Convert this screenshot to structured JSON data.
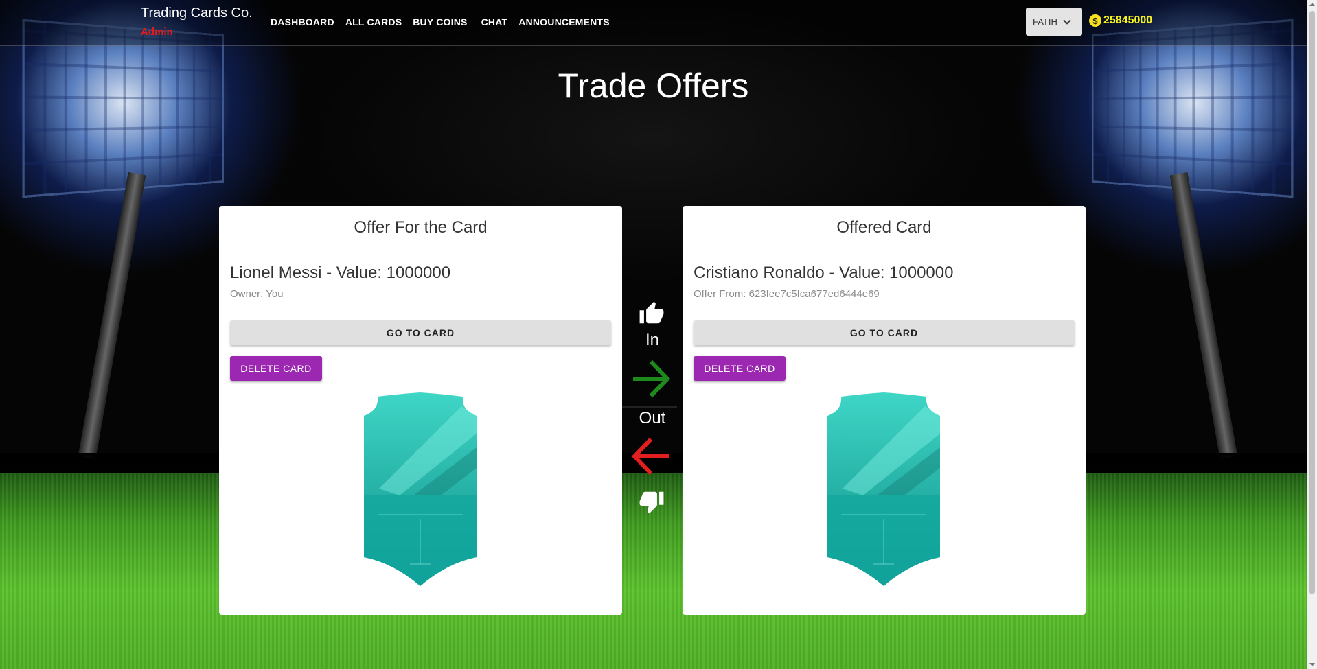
{
  "navbar": {
    "brand": "Trading Cards Co.",
    "role": "Admin",
    "links": [
      "DASHBOARD",
      "ALL CARDS",
      "BUY COINS",
      "CHAT",
      "ANNOUNCEMENTS"
    ],
    "user": "FATIH",
    "coins": "25845000",
    "coin_icon": "dollar-coin-icon"
  },
  "page": {
    "title": "Trade Offers"
  },
  "offer_card": {
    "title": "Offer For the Card",
    "player": "Lionel Messi - Value: 1000000",
    "subtitle": "Owner: You",
    "goto_label": "GO TO CARD",
    "delete_label": "DELETE CARD"
  },
  "offered_card": {
    "title": "Offered Card",
    "player": "Cristiano Ronaldo - Value: 1000000",
    "subtitle": "Offer From: 623fee7c5fca677ed6444e69",
    "goto_label": "GO TO CARD",
    "delete_label": "DELETE CARD"
  },
  "middle": {
    "in_label": "In",
    "out_label": "Out",
    "accept_icon": "thumbs-up-icon",
    "reject_icon": "thumbs-down-icon",
    "in_arrow_color": "#1e8a1e",
    "out_arrow_color": "#e31e1e"
  },
  "colors": {
    "delete_button": "#9c27b0",
    "coins_text": "#f7f31d",
    "role_text": "#e21b1b",
    "card_teal": "#2fc4b8"
  }
}
